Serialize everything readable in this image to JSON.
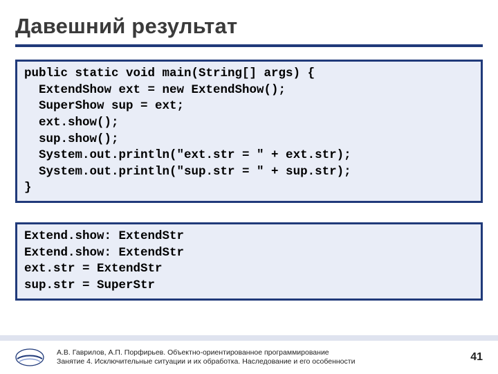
{
  "title": "Давешний результат",
  "code": "public static void main(String[] args) {\n  ExtendShow ext = new ExtendShow();\n  SuperShow sup = ext;\n  ext.show();\n  sup.show();\n  System.out.println(\"ext.str = \" + ext.str);\n  System.out.println(\"sup.str = \" + sup.str);\n}",
  "output": "Extend.show: ExtendStr\nExtend.show: ExtendStr\next.str = ExtendStr\nsup.str = SuperStr",
  "footer": {
    "line1": "А.В. Гаврилов, А.П. Порфирьев. Объектно-ориентированное программирование",
    "line2": "Занятие 4. Исключительные ситуации и их обработка. Наследование и его особенности",
    "page": "41"
  }
}
